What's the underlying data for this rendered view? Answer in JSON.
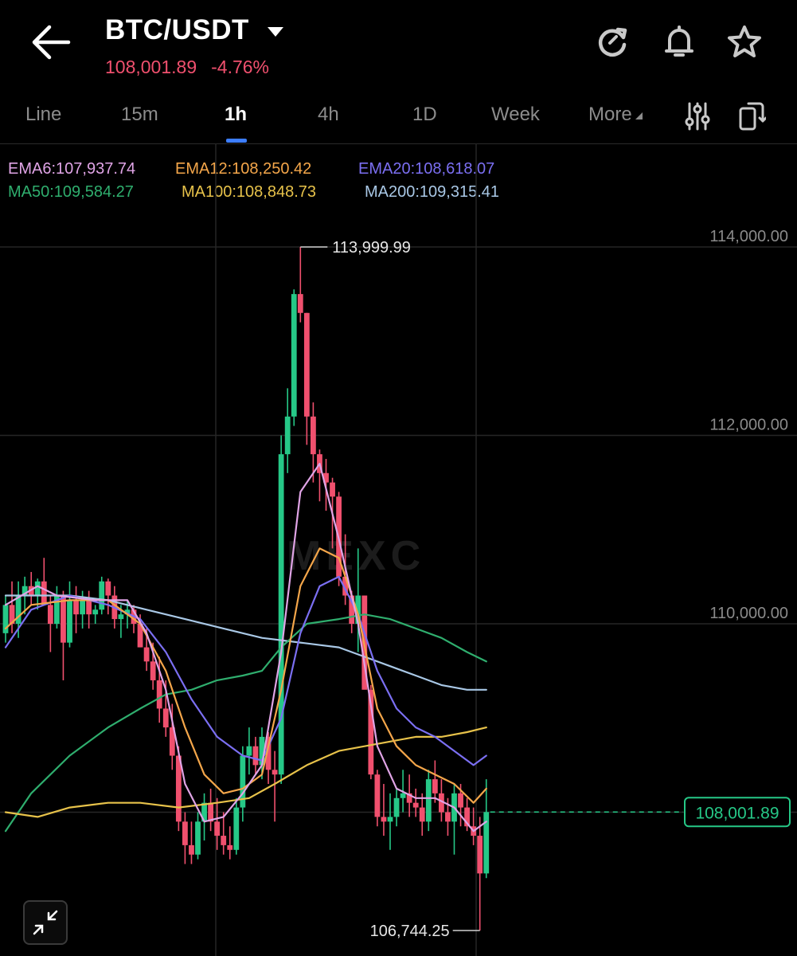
{
  "header": {
    "pair": "BTC/USDT",
    "last_price": "108,001.89",
    "change_pct": "-4.76%",
    "icons": [
      "back-arrow-icon",
      "caret-down-icon",
      "refresh-icon",
      "bell-icon",
      "star-icon"
    ]
  },
  "tabs": [
    {
      "label": "Line"
    },
    {
      "label": "15m"
    },
    {
      "label": "1h",
      "active": true
    },
    {
      "label": "4h"
    },
    {
      "label": "1D"
    },
    {
      "label": "Week"
    },
    {
      "label": "More"
    }
  ],
  "toolbar_icons": [
    "indicator-settings-icon",
    "rotate-screen-icon"
  ],
  "indicators": {
    "ema6": "EMA6:107,937.74",
    "ema12": "EMA12:108,250.42",
    "ema20": "EMA20:108,618.07",
    "ma50": "MA50:109,584.27",
    "ma100": "MA100:108,848.73",
    "ma200": "MA200:109,315.41"
  },
  "colors": {
    "up": "#26c887",
    "down": "#f0506e",
    "ema6": "#e0a4e6",
    "ema12": "#f4a64a",
    "ema20": "#7b6ff2",
    "ma50": "#2fae6e",
    "ma100": "#e7c24a",
    "ma200": "#a9c8e6"
  },
  "chart_data": {
    "type": "candlestick",
    "y_axis_labels": [
      "114,000.00",
      "112,000.00",
      "110,000.00"
    ],
    "ylim": [
      106500,
      114500
    ],
    "high_marker": "113,999.99",
    "low_marker": "106,744.25",
    "current_price_label": "108,001.89",
    "watermark": "MEXC",
    "candles": [
      [
        109900,
        110300,
        109800,
        110200
      ],
      [
        110200,
        110450,
        109900,
        110000
      ],
      [
        110000,
        110450,
        109850,
        110300
      ],
      [
        110300,
        110500,
        110100,
        110400
      ],
      [
        110400,
        110550,
        110200,
        110300
      ],
      [
        110300,
        110480,
        110150,
        110450
      ],
      [
        110450,
        110700,
        110300,
        110200
      ],
      [
        110200,
        110300,
        109700,
        110000
      ],
      [
        110000,
        110400,
        109950,
        110300
      ],
      [
        110300,
        110350,
        109400,
        109800
      ],
      [
        109800,
        110450,
        109750,
        110250
      ],
      [
        110250,
        110400,
        109900,
        110100
      ],
      [
        110100,
        110350,
        109950,
        110250
      ],
      [
        110250,
        110350,
        109950,
        110100
      ],
      [
        110100,
        110200,
        110000,
        110150
      ],
      [
        110150,
        110500,
        110100,
        110450
      ],
      [
        110450,
        110480,
        110100,
        110300
      ],
      [
        110300,
        110400,
        109950,
        110050
      ],
      [
        110050,
        110200,
        109850,
        110100
      ],
      [
        110100,
        110250,
        109950,
        110150
      ],
      [
        110150,
        110200,
        109900,
        110000
      ],
      [
        110000,
        110100,
        109750,
        109750
      ],
      [
        109750,
        109950,
        109500,
        109600
      ],
      [
        109600,
        109800,
        109300,
        109400
      ],
      [
        109400,
        109650,
        108950,
        109100
      ],
      [
        109100,
        109400,
        108800,
        108900
      ],
      [
        108900,
        109150,
        108450,
        108600
      ],
      [
        108600,
        108700,
        107800,
        107900
      ],
      [
        107900,
        108000,
        107450,
        107650
      ],
      [
        107650,
        107900,
        107450,
        107550
      ],
      [
        107550,
        108000,
        107500,
        107900
      ],
      [
        107900,
        108200,
        107700,
        108100
      ],
      [
        108100,
        108250,
        107800,
        107900
      ],
      [
        107900,
        108150,
        107600,
        107750
      ],
      [
        107750,
        108000,
        107550,
        107650
      ],
      [
        107650,
        107850,
        107500,
        107600
      ],
      [
        107600,
        108150,
        107550,
        108050
      ],
      [
        108050,
        108700,
        107900,
        108600
      ],
      [
        108600,
        108900,
        108400,
        108700
      ],
      [
        108700,
        108800,
        108400,
        108500
      ],
      [
        108500,
        108900,
        108350,
        108800
      ],
      [
        108800,
        108850,
        108300,
        108450
      ],
      [
        108450,
        108650,
        107900,
        108400
      ],
      [
        108400,
        112000,
        108300,
        111800
      ],
      [
        111800,
        112500,
        111600,
        112200
      ],
      [
        112200,
        113550,
        112100,
        113500
      ],
      [
        113500,
        113999.99,
        113200,
        113300
      ],
      [
        113300,
        113300,
        111900,
        112200
      ],
      [
        112200,
        112350,
        111500,
        111800
      ],
      [
        111800,
        111850,
        111300,
        111600
      ],
      [
        111600,
        111750,
        111200,
        111500
      ],
      [
        111500,
        111550,
        110800,
        111350
      ],
      [
        111350,
        111400,
        110400,
        110500
      ],
      [
        110500,
        110950,
        110200,
        110300
      ],
      [
        110300,
        110350,
        109900,
        110000
      ],
      [
        110000,
        110800,
        109700,
        110300
      ],
      [
        110300,
        110300,
        109600,
        109300
      ],
      [
        109300,
        109350,
        108350,
        108400
      ],
      [
        108400,
        108450,
        107850,
        107950
      ],
      [
        107950,
        108300,
        107750,
        107900
      ],
      [
        107900,
        108200,
        107600,
        107950
      ],
      [
        107950,
        108250,
        107850,
        108150
      ],
      [
        108150,
        108450,
        108000,
        108200
      ],
      [
        108200,
        108400,
        107950,
        108100
      ],
      [
        108100,
        108250,
        107950,
        108050
      ],
      [
        108050,
        108200,
        107750,
        107900
      ],
      [
        107900,
        108450,
        107800,
        108350
      ],
      [
        108350,
        108550,
        108100,
        108200
      ],
      [
        108200,
        108350,
        107900,
        108000
      ],
      [
        108000,
        108150,
        107750,
        107900
      ],
      [
        107900,
        108300,
        107550,
        108200
      ],
      [
        108200,
        108300,
        107850,
        108050
      ],
      [
        108050,
        108150,
        107800,
        107850
      ],
      [
        107850,
        108050,
        107650,
        107750
      ],
      [
        107750,
        107950,
        106744.25,
        107350
      ],
      [
        107350,
        108350,
        107300,
        108001.89
      ]
    ],
    "ma_lines": {
      "ema6": [
        [
          0,
          110200
        ],
        [
          5,
          110400
        ],
        [
          8,
          110300
        ],
        [
          14,
          110250
        ],
        [
          19,
          110250
        ],
        [
          22,
          109900
        ],
        [
          25,
          109300
        ],
        [
          28,
          108300
        ],
        [
          31,
          107900
        ],
        [
          34,
          107950
        ],
        [
          37,
          108200
        ],
        [
          40,
          108500
        ],
        [
          43,
          109700
        ],
        [
          46,
          111400
        ],
        [
          49,
          111700
        ],
        [
          52,
          110900
        ],
        [
          55,
          110000
        ],
        [
          58,
          108700
        ],
        [
          61,
          108250
        ],
        [
          64,
          108150
        ],
        [
          67,
          108150
        ],
        [
          70,
          108050
        ],
        [
          73,
          107800
        ],
        [
          75,
          107900
        ]
      ],
      "ema12": [
        [
          0,
          109950
        ],
        [
          4,
          110200
        ],
        [
          10,
          110250
        ],
        [
          16,
          110250
        ],
        [
          21,
          110000
        ],
        [
          25,
          109500
        ],
        [
          28,
          108900
        ],
        [
          31,
          108400
        ],
        [
          34,
          108200
        ],
        [
          37,
          108250
        ],
        [
          40,
          108400
        ],
        [
          43,
          109300
        ],
        [
          46,
          110400
        ],
        [
          49,
          110800
        ],
        [
          52,
          110700
        ],
        [
          55,
          110100
        ],
        [
          58,
          109100
        ],
        [
          61,
          108700
        ],
        [
          64,
          108500
        ],
        [
          67,
          108400
        ],
        [
          70,
          108300
        ],
        [
          73,
          108100
        ],
        [
          75,
          108250
        ]
      ],
      "ema20": [
        [
          0,
          109750
        ],
        [
          4,
          110150
        ],
        [
          10,
          110300
        ],
        [
          16,
          110200
        ],
        [
          21,
          110050
        ],
        [
          25,
          109700
        ],
        [
          29,
          109200
        ],
        [
          33,
          108800
        ],
        [
          37,
          108600
        ],
        [
          40,
          108550
        ],
        [
          43,
          109000
        ],
        [
          46,
          109900
        ],
        [
          49,
          110400
        ],
        [
          52,
          110500
        ],
        [
          55,
          110100
        ],
        [
          58,
          109500
        ],
        [
          61,
          109100
        ],
        [
          64,
          108900
        ],
        [
          67,
          108800
        ],
        [
          70,
          108650
        ],
        [
          73,
          108500
        ],
        [
          75,
          108600
        ]
      ],
      "ma50": [
        [
          0,
          107800
        ],
        [
          4,
          108200
        ],
        [
          10,
          108600
        ],
        [
          16,
          108900
        ],
        [
          21,
          109100
        ],
        [
          25,
          109250
        ],
        [
          29,
          109300
        ],
        [
          33,
          109400
        ],
        [
          37,
          109450
        ],
        [
          40,
          109500
        ],
        [
          43,
          109750
        ],
        [
          47,
          110000
        ],
        [
          52,
          110050
        ],
        [
          56,
          110100
        ],
        [
          60,
          110050
        ],
        [
          64,
          109950
        ],
        [
          68,
          109850
        ],
        [
          72,
          109700
        ],
        [
          75,
          109600
        ]
      ],
      "ma100": [
        [
          0,
          108000
        ],
        [
          5,
          107950
        ],
        [
          10,
          108050
        ],
        [
          16,
          108100
        ],
        [
          21,
          108100
        ],
        [
          27,
          108050
        ],
        [
          33,
          108100
        ],
        [
          38,
          108150
        ],
        [
          42,
          108300
        ],
        [
          47,
          108500
        ],
        [
          52,
          108650
        ],
        [
          56,
          108700
        ],
        [
          60,
          108750
        ],
        [
          64,
          108800
        ],
        [
          68,
          108800
        ],
        [
          72,
          108850
        ],
        [
          75,
          108900
        ]
      ],
      "ma200": [
        [
          0,
          110300
        ],
        [
          5,
          110300
        ],
        [
          10,
          110300
        ],
        [
          16,
          110250
        ],
        [
          22,
          110150
        ],
        [
          28,
          110050
        ],
        [
          34,
          109950
        ],
        [
          40,
          109850
        ],
        [
          46,
          109800
        ],
        [
          52,
          109750
        ],
        [
          56,
          109650
        ],
        [
          60,
          109550
        ],
        [
          64,
          109450
        ],
        [
          68,
          109350
        ],
        [
          72,
          109300
        ],
        [
          75,
          109300
        ]
      ]
    }
  }
}
